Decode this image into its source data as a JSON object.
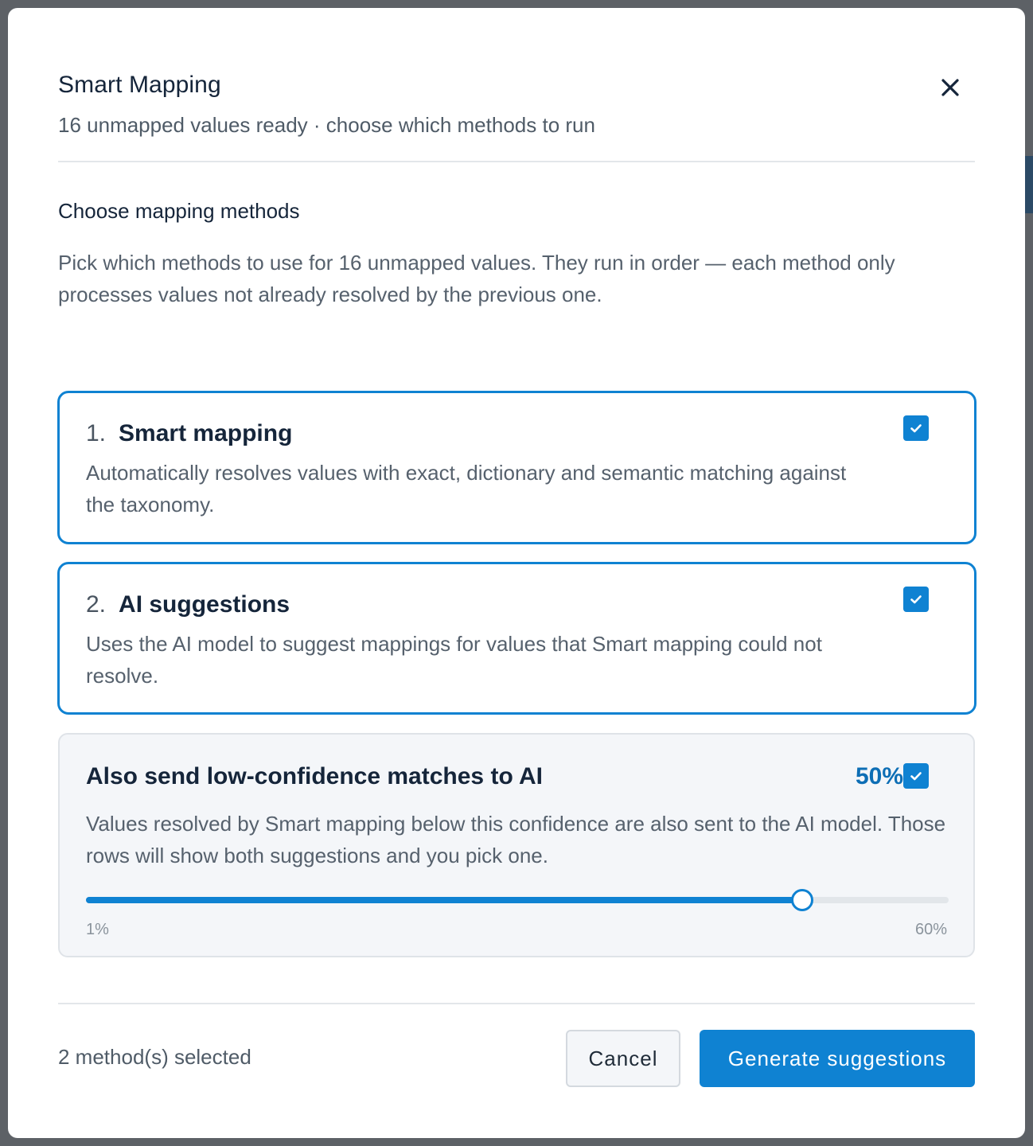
{
  "modal": {
    "title": "Smart Mapping",
    "subtitle": "16 unmapped values ready · choose which methods to run",
    "close_icon": "close-icon"
  },
  "section": {
    "title": "Choose mapping methods",
    "description": "Pick which methods to use for 16 unmapped values. They run in order — each method only processes values not already resolved by the previous one."
  },
  "methods": [
    {
      "number": "1.",
      "name": "Smart mapping",
      "description": "Automatically resolves values with exact, dictionary and semantic matching against the taxonomy.",
      "checked": true
    },
    {
      "number": "2.",
      "name": "AI suggestions",
      "description": "Uses the AI model to suggest mappings for values that Smart mapping could not resolve.",
      "checked": true
    }
  ],
  "low_confidence": {
    "title": "Also send low-confidence matches to AI",
    "percent_label": "50%",
    "checked": true,
    "description": "Values resolved by Smart mapping below this confidence are also sent to the AI model. Those rows will show both suggestions and you pick one.",
    "slider": {
      "min": 1,
      "max": 60,
      "value": 50,
      "min_label": "1%",
      "max_label": "60%"
    }
  },
  "footer": {
    "status": "2 method(s) selected",
    "cancel_label": "Cancel",
    "generate_label": "Generate suggestions"
  },
  "colors": {
    "accent": "#0f82d2",
    "percent_text": "#0d6eb5"
  }
}
